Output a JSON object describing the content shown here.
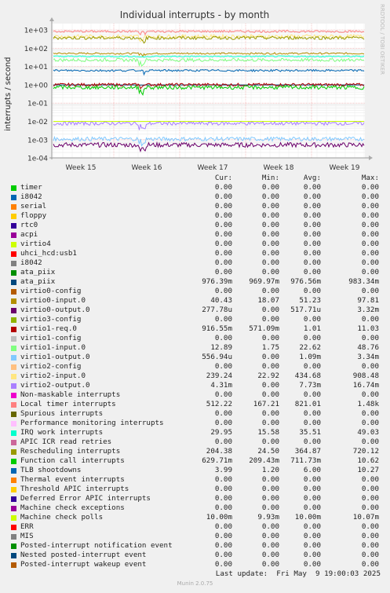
{
  "chart_data": {
    "type": "line",
    "title": "Individual interrupts - by month",
    "ylabel": "interrupts / second",
    "yscale": "log",
    "ylim": [
      0.0001,
      1000
    ],
    "grid": true,
    "y_tick_labels": [
      "1e+03",
      "1e+02",
      "1e+01",
      "1e+00",
      "1e-01",
      "1e-02",
      "1e-03",
      "1e-04"
    ],
    "x_tick_labels": [
      "Week 15",
      "Week 16",
      "Week 17",
      "Week 18",
      "Week 19"
    ],
    "series": [
      {
        "name": "timer",
        "color": "#00cc00",
        "cur": 0,
        "min": 0,
        "avg": 0,
        "max": 0
      },
      {
        "name": "i8042",
        "color": "#0066b3",
        "cur": 0,
        "min": 0,
        "avg": 0,
        "max": 0
      },
      {
        "name": "serial",
        "color": "#ff8000",
        "cur": 0,
        "min": 0,
        "avg": 0,
        "max": 0
      },
      {
        "name": "floppy",
        "color": "#ffcc00",
        "cur": 0,
        "min": 0,
        "avg": 0,
        "max": 0
      },
      {
        "name": "rtc0",
        "color": "#330099",
        "cur": 0,
        "min": 0,
        "avg": 0,
        "max": 0
      },
      {
        "name": "acpi",
        "color": "#990099",
        "cur": 0,
        "min": 0,
        "avg": 0,
        "max": 0
      },
      {
        "name": "virtio4",
        "color": "#ccff00",
        "cur": 0,
        "min": 0,
        "avg": 0,
        "max": 0
      },
      {
        "name": "uhci_hcd:usb1",
        "color": "#ff0000",
        "cur": 0,
        "min": 0,
        "avg": 0,
        "max": 0
      },
      {
        "name": "i8042",
        "color": "#808080",
        "cur": 0,
        "min": 0,
        "avg": 0,
        "max": 0
      },
      {
        "name": "ata_piix",
        "color": "#008f00",
        "cur": 0,
        "min": 0,
        "avg": 0,
        "max": 0
      },
      {
        "name": "ata_piix",
        "color": "#00487d",
        "cur": 0.97639,
        "min": 0.96997,
        "avg": 0.9765,
        "max": 0.98334
      },
      {
        "name": "virtio0-config",
        "color": "#b35a00",
        "cur": 0,
        "min": 0,
        "avg": 0,
        "max": 0
      },
      {
        "name": "virtio0-input.0",
        "color": "#b38f00",
        "cur": 40.43,
        "min": 18.07,
        "avg": 51.23,
        "max": 97.81
      },
      {
        "name": "virtio0-output.0",
        "color": "#6b006b",
        "cur": 0.00027778,
        "min": 0,
        "avg": 0.00051771,
        "max": 0.00332
      },
      {
        "name": "virtio3-config",
        "color": "#8fb300",
        "cur": 0,
        "min": 0,
        "avg": 0,
        "max": 0
      },
      {
        "name": "virtio1-req.0",
        "color": "#b30000",
        "cur": 0.91655,
        "min": 0.57109,
        "avg": 1.01,
        "max": 11.03
      },
      {
        "name": "virtio1-config",
        "color": "#bebebe",
        "cur": 0,
        "min": 0,
        "avg": 0,
        "max": 0
      },
      {
        "name": "virtio1-input.0",
        "color": "#80ff80",
        "cur": 12.89,
        "min": 1.75,
        "avg": 22.62,
        "max": 48.76
      },
      {
        "name": "virtio1-output.0",
        "color": "#80c9ff",
        "cur": 0.00055694,
        "min": 0,
        "avg": 0.00109,
        "max": 0.00334
      },
      {
        "name": "virtio2-config",
        "color": "#ffc080",
        "cur": 0,
        "min": 0,
        "avg": 0,
        "max": 0
      },
      {
        "name": "virtio2-input.0",
        "color": "#ffe680",
        "cur": 239.24,
        "min": 22.92,
        "avg": 434.68,
        "max": 908.48
      },
      {
        "name": "virtio2-output.0",
        "color": "#aa80ff",
        "cur": 0.00431,
        "min": 0,
        "avg": 0.00773,
        "max": 0.01674
      },
      {
        "name": "Non-maskable interrupts",
        "color": "#ee00cc",
        "cur": 0,
        "min": 0,
        "avg": 0,
        "max": 0
      },
      {
        "name": "Local timer interrupts",
        "color": "#ff8080",
        "cur": 512.22,
        "min": 167.21,
        "avg": 821.01,
        "max": 1480
      },
      {
        "name": "Spurious interrupts",
        "color": "#666600",
        "cur": 0,
        "min": 0,
        "avg": 0,
        "max": 0
      },
      {
        "name": "Performance monitoring interrupts",
        "color": "#ffbfff",
        "cur": 0,
        "min": 0,
        "avg": 0,
        "max": 0
      },
      {
        "name": "IRQ work interrupts",
        "color": "#00ffcc",
        "cur": 29.95,
        "min": 15.58,
        "avg": 35.51,
        "max": 49.03
      },
      {
        "name": "APIC ICR read retries",
        "color": "#cc6699",
        "cur": 0,
        "min": 0,
        "avg": 0,
        "max": 0
      },
      {
        "name": "Rescheduling interrupts",
        "color": "#999900",
        "cur": 204.38,
        "min": 24.5,
        "avg": 364.87,
        "max": 720.12
      },
      {
        "name": "Function call interrupts",
        "color": "#00cc00",
        "cur": 0.62971,
        "min": 0.20943,
        "avg": 0.71173,
        "max": 10.62
      },
      {
        "name": "TLB shootdowns",
        "color": "#0066b3",
        "cur": 3.99,
        "min": 1.2,
        "avg": 6,
        "max": 10.27
      },
      {
        "name": "Thermal event interrupts",
        "color": "#ff8000",
        "cur": 0,
        "min": 0,
        "avg": 0,
        "max": 0
      },
      {
        "name": "Threshold APIC interrupts",
        "color": "#ffcc00",
        "cur": 0,
        "min": 0,
        "avg": 0,
        "max": 0
      },
      {
        "name": "Deferred Error APIC interrupts",
        "color": "#330099",
        "cur": 0,
        "min": 0,
        "avg": 0,
        "max": 0
      },
      {
        "name": "Machine check exceptions",
        "color": "#990099",
        "cur": 0,
        "min": 0,
        "avg": 0,
        "max": 0
      },
      {
        "name": "Machine check polls",
        "color": "#ccff00",
        "cur": 0.01,
        "min": 0.00993,
        "avg": 0.01,
        "max": 0.01007
      },
      {
        "name": "ERR",
        "color": "#ff0000",
        "cur": 0,
        "min": 0,
        "avg": 0,
        "max": 0
      },
      {
        "name": "MIS",
        "color": "#808080",
        "cur": 0,
        "min": 0,
        "avg": 0,
        "max": 0
      },
      {
        "name": "Posted-interrupt notification event",
        "color": "#008f00",
        "cur": 0,
        "min": 0,
        "avg": 0,
        "max": 0
      },
      {
        "name": "Nested posted-interrupt event",
        "color": "#00487d",
        "cur": 0,
        "min": 0,
        "avg": 0,
        "max": 0
      },
      {
        "name": "Posted-interrupt wakeup event",
        "color": "#b35a00",
        "cur": 0,
        "min": 0,
        "avg": 0,
        "max": 0
      }
    ]
  },
  "legend": {
    "header": {
      "cur": "Cur:",
      "min": "Min:",
      "avg": "Avg:",
      "max": "Max:"
    },
    "rows": [
      {
        "name": "timer",
        "cur": "0.00",
        "min": "0.00",
        "avg": "0.00",
        "max": "0.00"
      },
      {
        "name": "i8042",
        "cur": "0.00",
        "min": "0.00",
        "avg": "0.00",
        "max": "0.00"
      },
      {
        "name": "serial",
        "cur": "0.00",
        "min": "0.00",
        "avg": "0.00",
        "max": "0.00"
      },
      {
        "name": "floppy",
        "cur": "0.00",
        "min": "0.00",
        "avg": "0.00",
        "max": "0.00"
      },
      {
        "name": "rtc0",
        "cur": "0.00",
        "min": "0.00",
        "avg": "0.00",
        "max": "0.00"
      },
      {
        "name": "acpi",
        "cur": "0.00",
        "min": "0.00",
        "avg": "0.00",
        "max": "0.00"
      },
      {
        "name": "virtio4",
        "cur": "0.00",
        "min": "0.00",
        "avg": "0.00",
        "max": "0.00"
      },
      {
        "name": "uhci_hcd:usb1",
        "cur": "0.00",
        "min": "0.00",
        "avg": "0.00",
        "max": "0.00"
      },
      {
        "name": "i8042",
        "cur": "0.00",
        "min": "0.00",
        "avg": "0.00",
        "max": "0.00"
      },
      {
        "name": "ata_piix",
        "cur": "0.00",
        "min": "0.00",
        "avg": "0.00",
        "max": "0.00"
      },
      {
        "name": "ata_piix",
        "cur": "976.39m",
        "min": "969.97m",
        "avg": "976.56m",
        "max": "983.34m"
      },
      {
        "name": "virtio0-config",
        "cur": "0.00",
        "min": "0.00",
        "avg": "0.00",
        "max": "0.00"
      },
      {
        "name": "virtio0-input.0",
        "cur": "40.43",
        "min": "18.07",
        "avg": "51.23",
        "max": "97.81"
      },
      {
        "name": "virtio0-output.0",
        "cur": "277.78u",
        "min": "0.00",
        "avg": "517.71u",
        "max": "3.32m"
      },
      {
        "name": "virtio3-config",
        "cur": "0.00",
        "min": "0.00",
        "avg": "0.00",
        "max": "0.00"
      },
      {
        "name": "virtio1-req.0",
        "cur": "916.55m",
        "min": "571.09m",
        "avg": "1.01",
        "max": "11.03"
      },
      {
        "name": "virtio1-config",
        "cur": "0.00",
        "min": "0.00",
        "avg": "0.00",
        "max": "0.00"
      },
      {
        "name": "virtio1-input.0",
        "cur": "12.89",
        "min": "1.75",
        "avg": "22.62",
        "max": "48.76"
      },
      {
        "name": "virtio1-output.0",
        "cur": "556.94u",
        "min": "0.00",
        "avg": "1.09m",
        "max": "3.34m"
      },
      {
        "name": "virtio2-config",
        "cur": "0.00",
        "min": "0.00",
        "avg": "0.00",
        "max": "0.00"
      },
      {
        "name": "virtio2-input.0",
        "cur": "239.24",
        "min": "22.92",
        "avg": "434.68",
        "max": "908.48"
      },
      {
        "name": "virtio2-output.0",
        "cur": "4.31m",
        "min": "0.00",
        "avg": "7.73m",
        "max": "16.74m"
      },
      {
        "name": "Non-maskable interrupts",
        "cur": "0.00",
        "min": "0.00",
        "avg": "0.00",
        "max": "0.00"
      },
      {
        "name": "Local timer interrupts",
        "cur": "512.22",
        "min": "167.21",
        "avg": "821.01",
        "max": "1.48k"
      },
      {
        "name": "Spurious interrupts",
        "cur": "0.00",
        "min": "0.00",
        "avg": "0.00",
        "max": "0.00"
      },
      {
        "name": "Performance monitoring interrupts",
        "cur": "0.00",
        "min": "0.00",
        "avg": "0.00",
        "max": "0.00"
      },
      {
        "name": "IRQ work interrupts",
        "cur": "29.95",
        "min": "15.58",
        "avg": "35.51",
        "max": "49.03"
      },
      {
        "name": "APIC ICR read retries",
        "cur": "0.00",
        "min": "0.00",
        "avg": "0.00",
        "max": "0.00"
      },
      {
        "name": "Rescheduling interrupts",
        "cur": "204.38",
        "min": "24.50",
        "avg": "364.87",
        "max": "720.12"
      },
      {
        "name": "Function call interrupts",
        "cur": "629.71m",
        "min": "209.43m",
        "avg": "711.73m",
        "max": "10.62"
      },
      {
        "name": "TLB shootdowns",
        "cur": "3.99",
        "min": "1.20",
        "avg": "6.00",
        "max": "10.27"
      },
      {
        "name": "Thermal event interrupts",
        "cur": "0.00",
        "min": "0.00",
        "avg": "0.00",
        "max": "0.00"
      },
      {
        "name": "Threshold APIC interrupts",
        "cur": "0.00",
        "min": "0.00",
        "avg": "0.00",
        "max": "0.00"
      },
      {
        "name": "Deferred Error APIC interrupts",
        "cur": "0.00",
        "min": "0.00",
        "avg": "0.00",
        "max": "0.00"
      },
      {
        "name": "Machine check exceptions",
        "cur": "0.00",
        "min": "0.00",
        "avg": "0.00",
        "max": "0.00"
      },
      {
        "name": "Machine check polls",
        "cur": "10.00m",
        "min": "9.93m",
        "avg": "10.00m",
        "max": "10.07m"
      },
      {
        "name": "ERR",
        "cur": "0.00",
        "min": "0.00",
        "avg": "0.00",
        "max": "0.00"
      },
      {
        "name": "MIS",
        "cur": "0.00",
        "min": "0.00",
        "avg": "0.00",
        "max": "0.00"
      },
      {
        "name": "Posted-interrupt notification event",
        "cur": "0.00",
        "min": "0.00",
        "avg": "0.00",
        "max": "0.00"
      },
      {
        "name": "Nested posted-interrupt event",
        "cur": "0.00",
        "min": "0.00",
        "avg": "0.00",
        "max": "0.00"
      },
      {
        "name": "Posted-interrupt wakeup event",
        "cur": "0.00",
        "min": "0.00",
        "avg": "0.00",
        "max": "0.00"
      }
    ]
  },
  "side_text": "RRDTOOL / TOBI OETIKER",
  "last_update": "Last update:  Fri May  9 19:00:03 2025",
  "version": "Munin 2.0.75"
}
